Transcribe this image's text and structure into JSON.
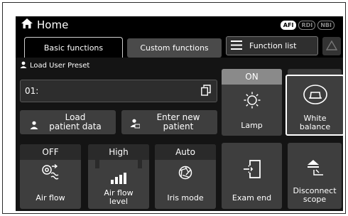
{
  "titlebar": {
    "title": "Home",
    "badges": [
      "AFI",
      "RDI",
      "NBI"
    ]
  },
  "tabs": {
    "basic": "Basic functions",
    "custom": "Custom functions",
    "function_list": "Function list"
  },
  "preset": {
    "label": "Load User Preset",
    "value": "01:"
  },
  "buttons": {
    "load_patient": [
      "Load",
      "patient data"
    ],
    "enter_patient": [
      "Enter new",
      "patient"
    ],
    "lamp": {
      "state": "ON",
      "label": "Lamp"
    },
    "white_balance": [
      "White",
      "balance"
    ],
    "air_flow": {
      "state": "OFF",
      "label": "Air flow"
    },
    "air_flow_level": {
      "state": "High",
      "label": [
        "Air flow",
        "level"
      ]
    },
    "iris_mode": {
      "state": "Auto",
      "label": "Iris mode"
    },
    "exam_end": "Exam end",
    "disconnect": [
      "Disconnect",
      "scope"
    ]
  },
  "icons": [
    "home-icon",
    "user-icon",
    "copy-icon",
    "patient-icon",
    "patient-new-icon",
    "lamp-icon",
    "white-balance-icon",
    "air-flow-icon",
    "signal-bars-icon",
    "aperture-icon",
    "exit-door-icon",
    "eject-icon",
    "warning-icon",
    "menu-icon"
  ]
}
